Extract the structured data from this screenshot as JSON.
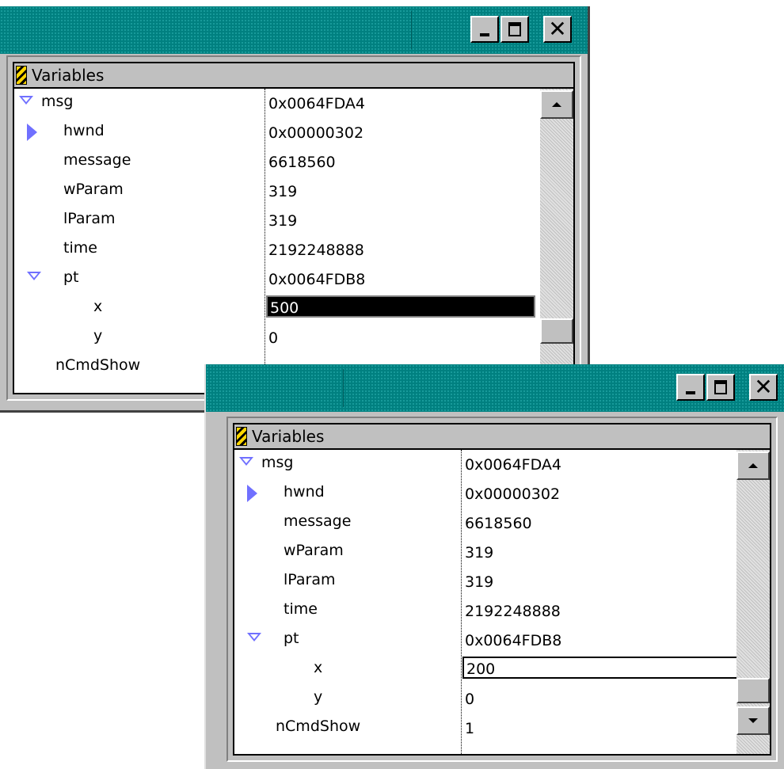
{
  "windows": [
    {
      "panel_header": "Variables",
      "buttons": {
        "minimize": "minimize",
        "maximize": "maximize",
        "close": "✕"
      },
      "rows": [
        {
          "name": "msg",
          "value": "0x0064FDA4",
          "expander": "expanded"
        },
        {
          "name": "hwnd",
          "value": "0x00000302",
          "expander": "collapsed"
        },
        {
          "name": "message",
          "value": "6618560",
          "expander": "none"
        },
        {
          "name": "wParam",
          "value": "319",
          "expander": "none"
        },
        {
          "name": "lParam",
          "value": "319",
          "expander": "none"
        },
        {
          "name": "time",
          "value": "2192248888",
          "expander": "none"
        },
        {
          "name": "pt",
          "value": "0x0064FDB8",
          "expander": "expanded"
        },
        {
          "name": "x",
          "value": "500",
          "expander": "none",
          "state": "selected"
        },
        {
          "name": "y",
          "value": "0",
          "expander": "none"
        },
        {
          "name": "nCmdShow",
          "value": "",
          "expander": "none"
        }
      ]
    },
    {
      "panel_header": "Variables",
      "buttons": {
        "minimize": "minimize",
        "maximize": "maximize",
        "close": "✕"
      },
      "rows": [
        {
          "name": "msg",
          "value": "0x0064FDA4",
          "expander": "expanded"
        },
        {
          "name": "hwnd",
          "value": "0x00000302",
          "expander": "collapsed"
        },
        {
          "name": "message",
          "value": "6618560",
          "expander": "none"
        },
        {
          "name": "wParam",
          "value": "319",
          "expander": "none"
        },
        {
          "name": "lParam",
          "value": "319",
          "expander": "none"
        },
        {
          "name": "time",
          "value": "2192248888",
          "expander": "none"
        },
        {
          "name": "pt",
          "value": "0x0064FDB8",
          "expander": "expanded"
        },
        {
          "name": "x",
          "value": "200",
          "expander": "none",
          "state": "editing"
        },
        {
          "name": "y",
          "value": "0",
          "expander": "none"
        },
        {
          "name": "nCmdShow",
          "value": "1",
          "expander": "none"
        }
      ]
    }
  ],
  "colors": {
    "titlebar": "#008080",
    "face": "#c0c0c0",
    "expander": "#7070ff",
    "selection": "#000000"
  }
}
